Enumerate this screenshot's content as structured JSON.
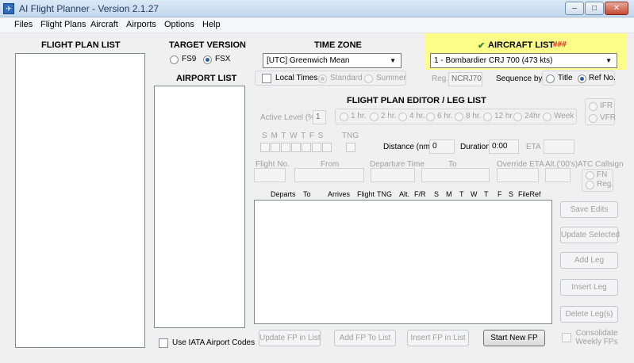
{
  "window": {
    "title": "AI Flight Planner - Version 2.1.27",
    "min": "‒",
    "max": "□",
    "close": "✕"
  },
  "menu": [
    "Files",
    "Flight Plans",
    "Aircraft",
    "Airports",
    "Options",
    "Help"
  ],
  "flight_plan_list": {
    "heading": "FLIGHT PLAN LIST"
  },
  "target_version": {
    "heading": "TARGET VERSION",
    "fs9": "FS9",
    "fsx": "FSX"
  },
  "airport_list": {
    "heading": "AIRPORT LIST",
    "iata_label": "Use IATA Airport Codes"
  },
  "time_zone": {
    "heading": "TIME ZONE",
    "value": "[UTC] Greenwich Mean",
    "local_times": "Local Times",
    "standard": "Standard",
    "summer": "Summer"
  },
  "aircraft_list": {
    "check": "✔",
    "heading": "AIRCRAFT LIST",
    "marker": "###",
    "value": "1 - Bombardier CRJ 700 (473 kts)",
    "reg_label": "Reg.",
    "reg_value": "NCRJ70",
    "sequence_label": "Sequence by",
    "title_opt": "Title",
    "ref_opt": "Ref No."
  },
  "editor": {
    "heading": "FLIGHT PLAN EDITOR / LEG LIST",
    "active_level_label": "Active Level (%)",
    "active_level_value": "1",
    "intervals": [
      "1 hr.",
      "2 hr.",
      "4 hr.",
      "6 hr.",
      "8 hr.",
      "12 hr",
      "24hr",
      "Week"
    ],
    "ifr": "IFR",
    "vfr": "VFR",
    "days_label": "S  M  T W T  F  S",
    "tng_label": "TNG",
    "distance_label": "Distance (nm)",
    "distance_value": "0",
    "duration_label": "Duration",
    "duration_value": "0:00",
    "eta_label": "ETA",
    "flight_no": "Flight No.",
    "from": "From",
    "departure_time": "Departure Time",
    "to": "To",
    "override_eta": "Override ETA",
    "alt": "Alt.('00's)",
    "atc_callsign": "ATC Callsign",
    "fn": "FN",
    "reg": "Reg.",
    "columns": [
      "Departs",
      "To",
      "Arrives",
      "Flight",
      "TNG",
      "Alt.",
      "F/R",
      "S",
      "M",
      "T",
      "W",
      "T",
      "F",
      "S",
      "FileRef"
    ]
  },
  "buttons": {
    "save_edits": "Save Edits",
    "update_selected": "Update Selected",
    "add_leg": "Add Leg",
    "insert_leg": "Insert Leg",
    "delete_legs": "Delete Leg(s)",
    "consolidate": "Consolidate Weekly FPs",
    "update_fp": "Update FP in List",
    "add_fp": "Add FP To List",
    "insert_fp": "Insert FP in List",
    "start_new_fp": "Start New FP"
  },
  "colors": {
    "highlight": "#fdfd8a",
    "marker_red": "#e02020",
    "check_green": "#2e8b2e"
  }
}
